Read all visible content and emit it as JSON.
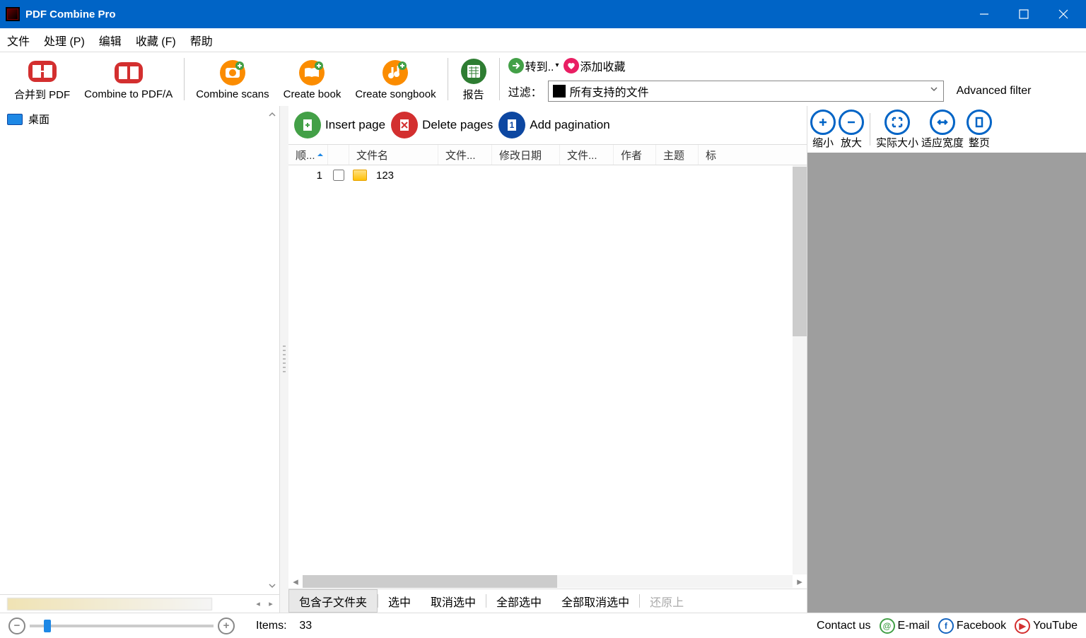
{
  "title": "PDF Combine Pro",
  "menu": {
    "file": "文件",
    "process": "处理 (P)",
    "edit": "编辑",
    "fav": "收藏 (F)",
    "help": "帮助"
  },
  "toolbar": {
    "merge": "合并到 PDF",
    "pdfa": "Combine to PDF/A",
    "scans": "Combine scans",
    "book": "Create book",
    "songbook": "Create songbook",
    "report": "报告",
    "goto": "转到..",
    "addfav": "添加收藏",
    "filter_label": "过滤：",
    "filter_value": "所有支持的文件",
    "adv_filter": "Advanced filter"
  },
  "sidebar": {
    "desktop": "桌面"
  },
  "page_actions": {
    "insert": "Insert page",
    "delete": "Delete pages",
    "pagin": "Add pagination"
  },
  "columns": {
    "order": "顺...",
    "name": "文件名",
    "file": "文件...",
    "mod": "修改日期",
    "file2": "文件...",
    "author": "作者",
    "subject": "主题",
    "tag": "标"
  },
  "rows": [
    {
      "idx": "1",
      "name": "123"
    }
  ],
  "selection": {
    "subfolders": "包含子文件夹",
    "select": "选中",
    "deselect": "取消选中",
    "select_all": "全部选中",
    "deselect_all": "全部取消选中",
    "restore": "还原上"
  },
  "zoom": {
    "out": "缩小",
    "in": "放大",
    "actual": "实际大小",
    "fitw": "适应宽度",
    "fitp": "整页"
  },
  "status": {
    "items_label": "Items:",
    "items_count": "33",
    "contact": "Contact us",
    "email": "E-mail",
    "fb": "Facebook",
    "yt": "YouTube"
  }
}
